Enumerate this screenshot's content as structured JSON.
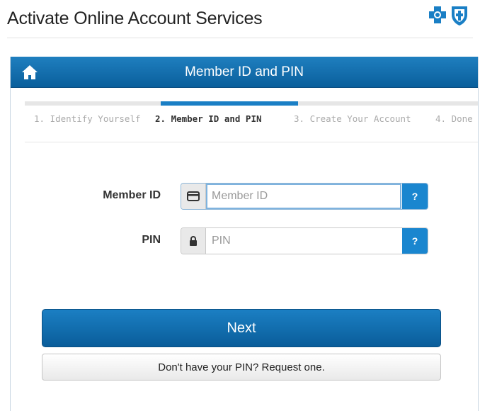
{
  "page": {
    "title": "Activate Online Account Services"
  },
  "header": {
    "home_icon": "home-icon",
    "title": "Member ID and PIN"
  },
  "steps": [
    {
      "label": "1. Identify Yourself",
      "active": false
    },
    {
      "label": "2. Member ID and PIN",
      "active": true
    },
    {
      "label": "3. Create Your Account",
      "active": false
    },
    {
      "label": "4. Done",
      "active": false
    }
  ],
  "form": {
    "member_id": {
      "label": "Member ID",
      "placeholder": "Member ID",
      "value": "",
      "icon": "id-card-icon",
      "help": "?"
    },
    "pin": {
      "label": "PIN",
      "placeholder": "PIN",
      "value": "",
      "icon": "lock-icon",
      "help": "?"
    }
  },
  "buttons": {
    "next": "Next",
    "request_pin": "Don't have your PIN? Request one."
  },
  "colors": {
    "brand": "#0a5f9c",
    "accent": "#1a86cf"
  }
}
